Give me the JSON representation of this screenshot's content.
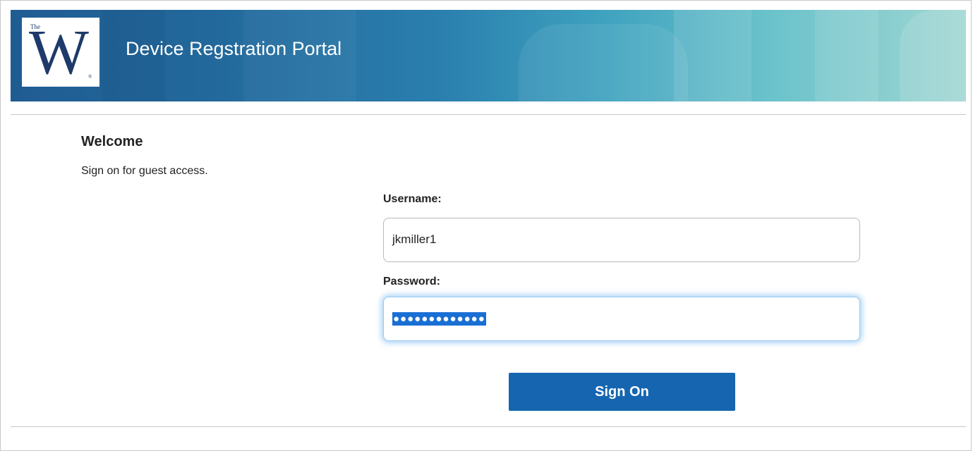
{
  "header": {
    "logo": {
      "small_text": "The",
      "letter": "W",
      "mark": "®"
    },
    "title": "Device Regstration Portal"
  },
  "main": {
    "heading": "Welcome",
    "subtitle": "Sign on for guest access."
  },
  "form": {
    "username_label": "Username:",
    "username_value": "jkmiller1",
    "password_label": "Password:",
    "password_value": "●●●●●●●●●●●●●",
    "submit_label": "Sign On"
  },
  "colors": {
    "accent": "#1565b0",
    "header_start": "#1f5c92",
    "header_end": "#9fd6d2",
    "logo_ink": "#1e3a6b"
  }
}
